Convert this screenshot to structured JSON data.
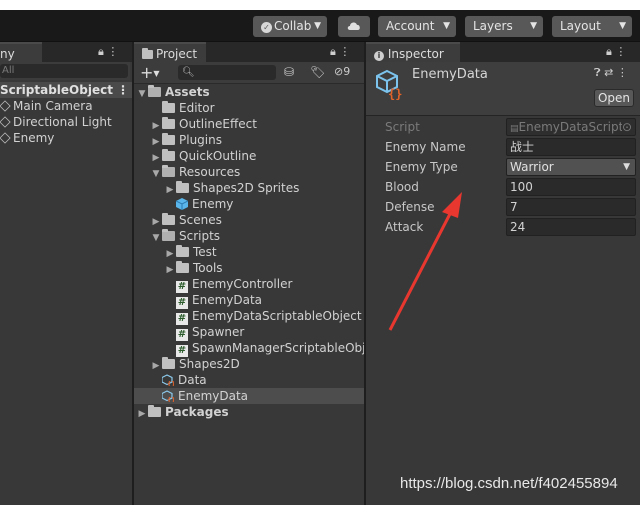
{
  "toolbar": {
    "collab": "Collab",
    "account": "Account",
    "layers": "Layers",
    "layout": "Layout"
  },
  "hierarchy": {
    "tab_label": "ny",
    "search_placeholder": "All",
    "scene": "ScriptableObject",
    "items": [
      "Main Camera",
      "Directional Light",
      "Enemy"
    ]
  },
  "project": {
    "tab_label": "Project",
    "hidden_count": "9",
    "tree": [
      {
        "label": "Assets",
        "depth": 0,
        "kind": "folder-open",
        "tri": "▼",
        "bold": true
      },
      {
        "label": "Editor",
        "depth": 1,
        "kind": "folder",
        "tri": ""
      },
      {
        "label": "OutlineEffect",
        "depth": 1,
        "kind": "folder",
        "tri": "▶"
      },
      {
        "label": "Plugins",
        "depth": 1,
        "kind": "folder",
        "tri": "▶"
      },
      {
        "label": "QuickOutline",
        "depth": 1,
        "kind": "folder",
        "tri": "▶"
      },
      {
        "label": "Resources",
        "depth": 1,
        "kind": "folder-open",
        "tri": "▼"
      },
      {
        "label": "Shapes2D Sprites",
        "depth": 2,
        "kind": "folder",
        "tri": "▶"
      },
      {
        "label": "Enemy",
        "depth": 2,
        "kind": "prefab",
        "tri": ""
      },
      {
        "label": "Scenes",
        "depth": 1,
        "kind": "folder",
        "tri": "▶"
      },
      {
        "label": "Scripts",
        "depth": 1,
        "kind": "folder-open",
        "tri": "▼"
      },
      {
        "label": "Test",
        "depth": 2,
        "kind": "folder",
        "tri": "▶"
      },
      {
        "label": "Tools",
        "depth": 2,
        "kind": "folder",
        "tri": "▶"
      },
      {
        "label": "EnemyController",
        "depth": 2,
        "kind": "script",
        "tri": ""
      },
      {
        "label": "EnemyData",
        "depth": 2,
        "kind": "script",
        "tri": ""
      },
      {
        "label": "EnemyDataScriptableObject",
        "depth": 2,
        "kind": "script",
        "tri": ""
      },
      {
        "label": "Spawner",
        "depth": 2,
        "kind": "script",
        "tri": ""
      },
      {
        "label": "SpawnManagerScriptableObje",
        "depth": 2,
        "kind": "script",
        "tri": ""
      },
      {
        "label": "Shapes2D",
        "depth": 1,
        "kind": "folder",
        "tri": "▶"
      },
      {
        "label": "Data",
        "depth": 1,
        "kind": "asset",
        "tri": ""
      },
      {
        "label": "EnemyData",
        "depth": 1,
        "kind": "asset",
        "tri": "",
        "selected": true
      },
      {
        "label": "Packages",
        "depth": 0,
        "kind": "folder",
        "tri": "▶",
        "bold": true
      }
    ]
  },
  "inspector": {
    "tab_label": "Inspector",
    "title": "EnemyData",
    "open_label": "Open",
    "script_label": "Script",
    "script_value": "EnemyDataScript",
    "fields": [
      {
        "label": "Enemy Name",
        "value": "战士",
        "kind": "text"
      },
      {
        "label": "Enemy Type",
        "value": "Warrior",
        "kind": "select"
      },
      {
        "label": "Blood",
        "value": "100",
        "kind": "text"
      },
      {
        "label": "Defense",
        "value": "7",
        "kind": "text"
      },
      {
        "label": "Attack",
        "value": "24",
        "kind": "text"
      }
    ]
  },
  "watermark": "https://blog.csdn.net/f402455894",
  "colors": {
    "annotation_arrow": "#e8372f",
    "selection": "#4d4d4d",
    "script_icon_bg": "#e8e8e8"
  }
}
